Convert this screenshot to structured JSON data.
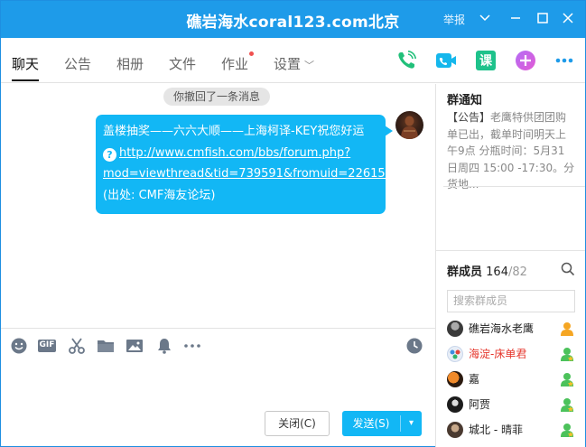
{
  "window": {
    "title": "礁岩海水coral123.com北京",
    "report_label": "举报",
    "controls": [
      "chevron-down-icon",
      "minimize-icon",
      "maximize-icon",
      "close-icon"
    ]
  },
  "tabs": [
    {
      "label": "聊天",
      "active": true
    },
    {
      "label": "公告"
    },
    {
      "label": "相册"
    },
    {
      "label": "文件"
    },
    {
      "label": "作业",
      "badge_dot": true
    },
    {
      "label": "设置",
      "has_dropdown": true
    }
  ],
  "app_icons": [
    "phone-call-icon",
    "video-call-icon",
    "course-icon",
    "add-app-icon",
    "more-icon"
  ],
  "app_icon_course_label": "课",
  "chat": {
    "system_message": "你撤回了一条消息",
    "message": {
      "line1": "盖楼抽奖——六六大顺——上海柯译-KEY祝您好运",
      "link": "http://www.cmfish.com/bbs/forum.php?mod=viewthread&tid=739591&fromuid=226151",
      "link_line1": "http://www.cmfish.com/bbs/forum.php?",
      "link_line2": "mod=viewthread&tid=739591&fromuid=226151",
      "source": "(出处: CMF海友论坛)"
    }
  },
  "toolbar": [
    "emoji-icon",
    "gif-icon",
    "scissors-icon",
    "folder-icon",
    "image-icon",
    "bell-icon",
    "more-dots-icon",
    "history-clock-icon"
  ],
  "toolbar_gif_label": "GIF",
  "buttons": {
    "close": "关闭(C)",
    "send": "发送(S)"
  },
  "notice": {
    "title": "群通知",
    "tag": "【公告】",
    "text": "老鹰特供团团购单已出，截单时间明天上午9点 分瓶时间：5月31日周四 15:00 -17:30。分货地..."
  },
  "members": {
    "title": "群成员",
    "count": "164",
    "total": "/82",
    "search_placeholder": "搜索群成员",
    "list": [
      {
        "name": "礁岩海水老鹰",
        "color": "normal",
        "role": "owner"
      },
      {
        "name": "海淀-床单君",
        "color": "red",
        "role": "admin"
      },
      {
        "name": "嘉",
        "color": "normal",
        "role": "admin"
      },
      {
        "name": "阿贾",
        "color": "normal",
        "role": "admin"
      },
      {
        "name": "城北 - 晴菲",
        "color": "normal",
        "role": "admin"
      }
    ]
  },
  "colors": {
    "title_bar": "#1e9be9",
    "bubble": "#12b7f5",
    "owner_badge": "#f5a623",
    "admin_badge": "#4cc25b",
    "name_red": "#e5342a"
  }
}
